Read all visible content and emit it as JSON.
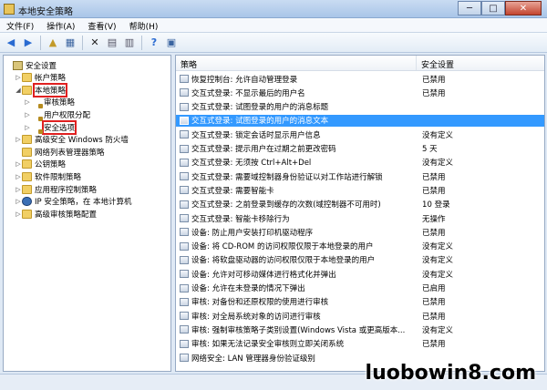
{
  "window": {
    "title": "本地安全策略",
    "minimize": "─",
    "maximize": "□",
    "close": "✕"
  },
  "menubar": [
    "文件(F)",
    "操作(A)",
    "查看(V)",
    "帮助(H)"
  ],
  "toolbar": {
    "icons": [
      "back-arrow-icon",
      "forward-arrow-icon",
      "up-folder-icon",
      "show-tree-icon",
      "delete-icon",
      "properties-icon",
      "export-icon",
      "help-icon",
      "view-icon"
    ]
  },
  "tree": [
    {
      "label": "安全设置",
      "level": 0,
      "arrow": "",
      "icon": "root"
    },
    {
      "label": "帐户策略",
      "level": 1,
      "arrow": "▷",
      "icon": "folder"
    },
    {
      "label": "本地策略",
      "level": 1,
      "arrow": "◢",
      "icon": "folder",
      "highlighted": true
    },
    {
      "label": "审核策略",
      "level": 2,
      "arrow": "▷",
      "icon": "lockfolder"
    },
    {
      "label": "用户权限分配",
      "level": 2,
      "arrow": "▷",
      "icon": "lockfolder"
    },
    {
      "label": "安全选项",
      "level": 2,
      "arrow": "▷",
      "icon": "lockfolder",
      "highlighted": true
    },
    {
      "label": "高级安全 Windows 防火墙",
      "level": 1,
      "arrow": "▷",
      "icon": "folder"
    },
    {
      "label": "网络列表管理器策略",
      "level": 1,
      "arrow": "",
      "icon": "folder"
    },
    {
      "label": "公钥策略",
      "level": 1,
      "arrow": "▷",
      "icon": "folder"
    },
    {
      "label": "软件限制策略",
      "level": 1,
      "arrow": "▷",
      "icon": "folder"
    },
    {
      "label": "应用程序控制策略",
      "level": 1,
      "arrow": "▷",
      "icon": "folder"
    },
    {
      "label": "IP 安全策略，在 本地计算机",
      "level": 1,
      "arrow": "▷",
      "icon": "ipsec"
    },
    {
      "label": "高级审核策略配置",
      "level": 1,
      "arrow": "▷",
      "icon": "folder"
    }
  ],
  "list": {
    "col_policy": "策略",
    "col_setting": "安全设置",
    "rows": [
      {
        "name": "恢复控制台: 允许自动管理登录",
        "value": "已禁用"
      },
      {
        "name": "交互式登录: 不显示最后的用户名",
        "value": "已禁用"
      },
      {
        "name": "交互式登录: 试图登录的用户的消息标题",
        "value": ""
      },
      {
        "name": "交互式登录: 试图登录的用户的消息文本",
        "value": "",
        "selected": true
      },
      {
        "name": "交互式登录: 锁定会话时显示用户信息",
        "value": "没有定义"
      },
      {
        "name": "交互式登录: 提示用户在过期之前更改密码",
        "value": "5 天"
      },
      {
        "name": "交互式登录: 无须按 Ctrl+Alt+Del",
        "value": "没有定义"
      },
      {
        "name": "交互式登录: 需要域控制器身份验证以对工作站进行解锁",
        "value": "已禁用"
      },
      {
        "name": "交互式登录: 需要智能卡",
        "value": "已禁用"
      },
      {
        "name": "交互式登录: 之前登录到缓存的次数(域控制器不可用时)",
        "value": "10 登录"
      },
      {
        "name": "交互式登录: 智能卡移除行为",
        "value": "无操作"
      },
      {
        "name": "设备: 防止用户安装打印机驱动程序",
        "value": "已禁用"
      },
      {
        "name": "设备: 将 CD-ROM 的访问权限仅限于本地登录的用户",
        "value": "没有定义"
      },
      {
        "name": "设备: 将软盘驱动器的访问权限仅限于本地登录的用户",
        "value": "没有定义"
      },
      {
        "name": "设备: 允许对可移动媒体进行格式化并弹出",
        "value": "没有定义"
      },
      {
        "name": "设备: 允许在未登录的情况下弹出",
        "value": "已启用"
      },
      {
        "name": "审核: 对备份和还原权限的使用进行审核",
        "value": "已禁用"
      },
      {
        "name": "审核: 对全局系统对象的访问进行审核",
        "value": "已禁用"
      },
      {
        "name": "审核: 强制审核策略子类别设置(Windows Vista 或更高版本...",
        "value": "没有定义"
      },
      {
        "name": "审核: 如果无法记录安全审核则立即关闭系统",
        "value": "已禁用"
      },
      {
        "name": "网络安全: LAN 管理器身份验证级别",
        "value": ""
      }
    ]
  },
  "watermark": "luobowin8.com"
}
